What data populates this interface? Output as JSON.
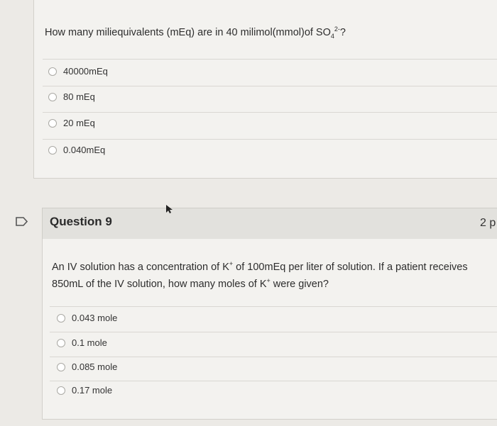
{
  "question8": {
    "text_prefix": "How many miliequivalents (mEq) are in 40 milimol(mmol)of SO",
    "text_sub": "4",
    "text_sup": "2-",
    "text_suffix": "?",
    "options": [
      "40000mEq",
      "80 mEq",
      "20 mEq",
      "0.040mEq"
    ]
  },
  "question9": {
    "title": "Question 9",
    "points": "2 p",
    "text_part1": "An IV solution has a concentration of K",
    "sup1": "+",
    "text_part2": " of 100mEq per liter of solution. If a patient receives 850mL of the IV solution, how many moles of K",
    "sup2": "+",
    "text_part3": " were given?",
    "options": [
      "0.043 mole",
      "0.1 mole",
      "0.085 mole",
      "0.17 mole"
    ]
  },
  "icons": {
    "flag": "flag-icon",
    "cursor": "cursor-arrow-icon"
  }
}
